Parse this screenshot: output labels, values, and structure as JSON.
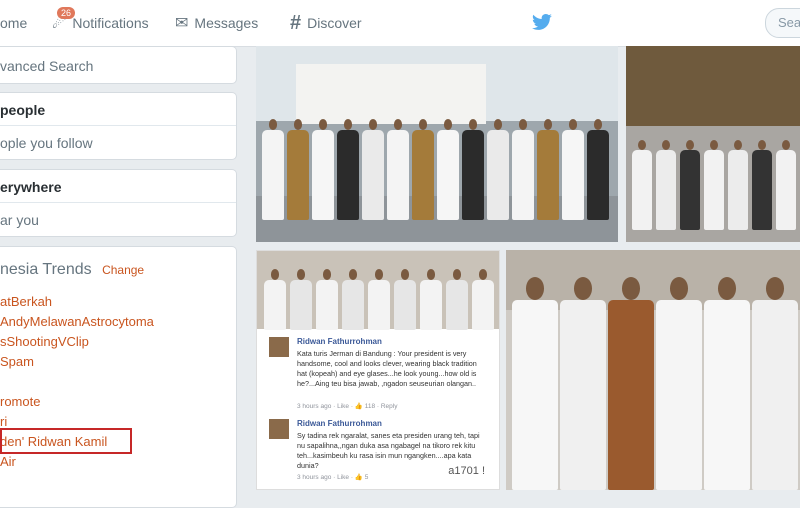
{
  "nav": {
    "home": "ome",
    "notifications": "Notifications",
    "notifications_badge": "26",
    "messages": "Messages",
    "discover": "Discover",
    "search_placeholder": "Sea"
  },
  "sidebar": {
    "advanced_search": "vanced Search",
    "people_title": "people",
    "people_filter": "ople you follow",
    "location_title": "erywhere",
    "location_filter": "ar you",
    "trends_title": "nesia Trends",
    "trends_change": "Change",
    "trends": [
      "atBerkah",
      "AndyMelawanAstrocytoma",
      "sShootingVClip",
      "Spam",
      "",
      "romote",
      "ri",
      "den' Ridwan Kamil",
      "Air"
    ],
    "highlighted_trend_index": 7
  },
  "comments": [
    {
      "name": "Ridwan Fathurrohman",
      "text": "Kata turis Jerman di Bandung : Your president is very handsome, cool and looks clever, wearing black tradition hat (kopeah) and eye glases...he look young...how old is he?...Aing teu bisa jawab, ,ngadon seuseurian olangan..",
      "meta": "3 hours ago · Like · 👍 118 · Reply"
    },
    {
      "name": "Ridwan Fathurrohman",
      "text": "Sy tadina rek ngaralat, sanes eta presiden urang teh, tapi nu sapalihna,,ngan duka asa ngabagel na tikoro rek kitu teh...kasimbeuh ku rasa isin mun ngangken....apa kata dunia?",
      "meta": "3 hours ago · Like · 👍 5"
    }
  ],
  "watermark": "a1701 !",
  "colors": {
    "link": "#c9551f",
    "twitter_blue": "#55acee",
    "highlight_box": "#c62828"
  }
}
